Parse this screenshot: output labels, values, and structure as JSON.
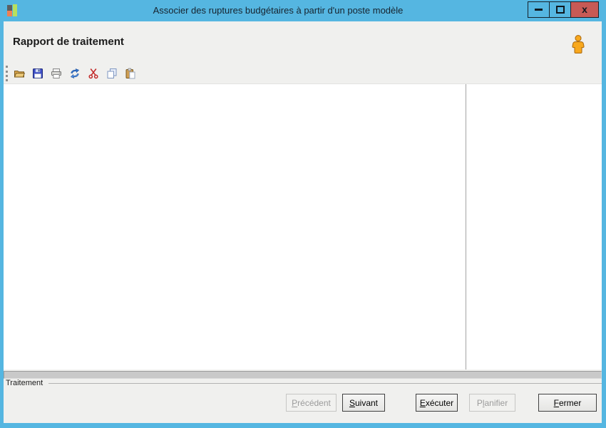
{
  "window": {
    "title": "Associer des ruptures budgétaires à partir d'un poste modèle",
    "controls": {
      "close_glyph": "x"
    }
  },
  "header": {
    "title": "Rapport de traitement"
  },
  "toolbar": {
    "items": [
      "open-folder",
      "save",
      "print",
      "refresh",
      "cut",
      "copy",
      "paste"
    ]
  },
  "report": {
    "content": ""
  },
  "status": {
    "progress_percent": 0
  },
  "groupbox": {
    "label": "Traitement"
  },
  "buttons": [
    {
      "pre": "",
      "accel": "P",
      "post": "récédent",
      "enabled": false
    },
    {
      "pre": "",
      "accel": "S",
      "post": "uivant",
      "enabled": true
    },
    {
      "pre": "",
      "accel": "E",
      "post": "xécuter",
      "enabled": true
    },
    {
      "pre": "P",
      "accel": "l",
      "post": "anifier",
      "enabled": false
    },
    {
      "pre": "",
      "accel": "F",
      "post": "ermer",
      "enabled": true
    }
  ],
  "colors": {
    "titlebar_blue": "#55b6e1",
    "close_red": "#c75a55",
    "client_bg": "#f0f0ee",
    "content_bg": "#ffffff",
    "person_orange": "#f8a81d"
  }
}
